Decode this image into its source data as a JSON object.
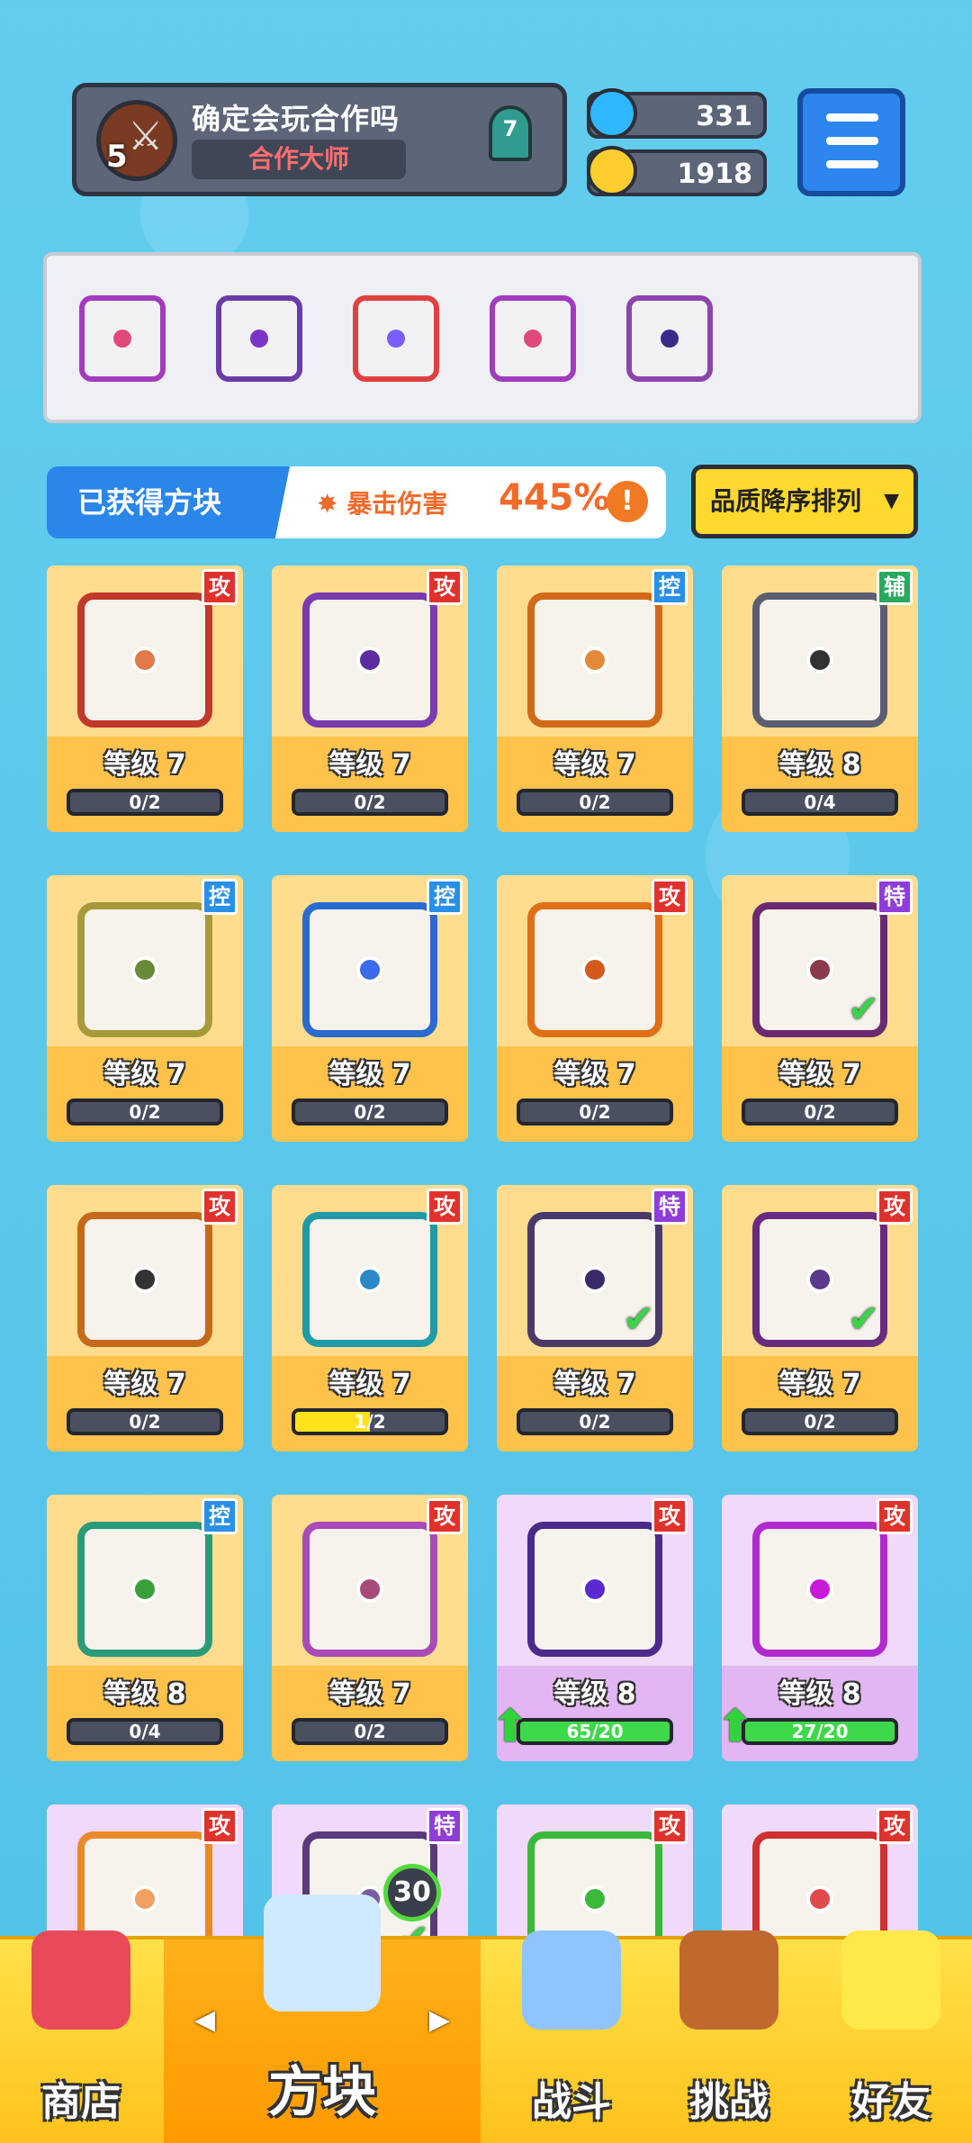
{
  "player": {
    "name": "确定会玩合作吗",
    "title": "合作大师",
    "level": "5",
    "rank": "7"
  },
  "currency": {
    "gems": "331",
    "gold": "1918"
  },
  "deck": [
    {
      "icon": "combo-block",
      "color": "#a23bc0",
      "dot": "#e04a7a"
    },
    {
      "icon": "vortex-block",
      "color": "#6b3ba8",
      "dot": "#7a34c8"
    },
    {
      "icon": "rainbow-block",
      "color": "#e04040",
      "dot": "#7a5cff"
    },
    {
      "icon": "crossbow-block",
      "color": "#a23bc0",
      "dot": "#e04a7a"
    },
    {
      "icon": "lightning-block",
      "color": "#8e44ad",
      "dot": "#3a2a8a"
    }
  ],
  "obtained": {
    "label": "已获得方块",
    "stat_label": "暴击伤害",
    "stat_value": "445%",
    "info": "!"
  },
  "sort": {
    "label": "品质降序排列",
    "arrow": "▼"
  },
  "cards": [
    {
      "icon": "sun-block",
      "tag": "攻",
      "tag_type": "atk",
      "frame": "#c0392b",
      "dot": "#e07a4a",
      "level": "等级 7",
      "progress": "0/2",
      "fill": 0,
      "purple": false,
      "check": false
    },
    {
      "icon": "vortex-block",
      "tag": "攻",
      "tag_type": "atk",
      "frame": "#7a3bb0",
      "dot": "#5b2ea0",
      "level": "等级 7",
      "progress": "0/2",
      "fill": 0,
      "purple": false,
      "check": false
    },
    {
      "icon": "tornado-block",
      "tag": "控",
      "tag_type": "ctl",
      "frame": "#d06a18",
      "dot": "#e38a3a",
      "level": "等级 7",
      "progress": "0/2",
      "fill": 0,
      "purple": false,
      "check": false
    },
    {
      "icon": "fang-block",
      "tag": "辅",
      "tag_type": "sup",
      "frame": "#5a5e70",
      "dot": "#333",
      "level": "等级 8",
      "progress": "0/4",
      "fill": 0,
      "purple": false,
      "check": false
    },
    {
      "icon": "shield-block",
      "tag": "控",
      "tag_type": "ctl",
      "frame": "#a89a3a",
      "dot": "#6a8a3a",
      "level": "等级 7",
      "progress": "0/2",
      "fill": 0,
      "purple": false,
      "check": false
    },
    {
      "icon": "snowflake-block",
      "tag": "控",
      "tag_type": "ctl",
      "frame": "#2a6bd0",
      "dot": "#3a6be8",
      "level": "等级 7",
      "progress": "0/2",
      "fill": 0,
      "purple": false,
      "check": false
    },
    {
      "icon": "flame-block",
      "tag": "攻",
      "tag_type": "atk",
      "frame": "#e07018",
      "dot": "#d45a1a",
      "level": "等级 7",
      "progress": "0/2",
      "fill": 0,
      "purple": false,
      "check": false
    },
    {
      "icon": "crossed-swords-block",
      "tag": "特",
      "tag_type": "spe",
      "frame": "#6a2a70",
      "dot": "#8a3a4a",
      "level": "等级 7",
      "progress": "0/2",
      "fill": 0,
      "purple": false,
      "check": true
    },
    {
      "icon": "pistol-block",
      "tag": "攻",
      "tag_type": "atk",
      "frame": "#c46a1a",
      "dot": "#333",
      "level": "等级 7",
      "progress": "0/2",
      "fill": 0,
      "purple": false,
      "check": false
    },
    {
      "icon": "whirlpool-block",
      "tag": "攻",
      "tag_type": "atk",
      "frame": "#1f9aa8",
      "dot": "#2a8ac8",
      "level": "等级 7",
      "progress": "1/2",
      "fill": 0.5,
      "purple": false,
      "check": false
    },
    {
      "icon": "void-block",
      "tag": "特",
      "tag_type": "spe",
      "frame": "#4a3a6a",
      "dot": "#3a2a6a",
      "level": "等级 7",
      "progress": "0/2",
      "fill": 0,
      "purple": false,
      "check": true
    },
    {
      "icon": "combo-block",
      "tag": "攻",
      "tag_type": "atk",
      "frame": "#6a2a80",
      "dot": "#5a3a8a",
      "level": "等级 7",
      "progress": "0/2",
      "fill": 0,
      "purple": false,
      "check": true
    },
    {
      "icon": "wind-block",
      "tag": "控",
      "tag_type": "ctl",
      "frame": "#2a9a7a",
      "dot": "#3aa03a",
      "level": "等级 8",
      "progress": "0/4",
      "fill": 0,
      "purple": false,
      "check": false
    },
    {
      "icon": "star-block",
      "tag": "攻",
      "tag_type": "atk",
      "frame": "#a84ab8",
      "dot": "#a84a7a",
      "level": "等级 7",
      "progress": "0/2",
      "fill": 0,
      "purple": false,
      "check": false
    },
    {
      "icon": "scythe-block",
      "tag": "攻",
      "tag_type": "atk",
      "frame": "#4a2a8a",
      "dot": "#5a2ad0",
      "level": "等级 8",
      "progress": "65/20",
      "fill": 1,
      "purple": true,
      "check": false,
      "upgrade": true
    },
    {
      "icon": "sparkle-block",
      "tag": "攻",
      "tag_type": "atk",
      "frame": "#b02ad0",
      "dot": "#c81ad8",
      "level": "等级 8",
      "progress": "27/20",
      "fill": 1,
      "purple": true,
      "check": false,
      "upgrade": true
    },
    {
      "icon": "crosshair-block",
      "tag": "攻",
      "tag_type": "atk",
      "frame": "#e88a2a",
      "dot": "#f0a060",
      "level": "",
      "progress": "",
      "fill": 0,
      "purple": true,
      "check": false,
      "partial": true
    },
    {
      "icon": "diamond-block",
      "tag": "特",
      "tag_type": "spe",
      "frame": "#5a3a7a",
      "dot": "#7a5aa0",
      "level": "",
      "progress": "",
      "fill": 0,
      "purple": true,
      "check": true,
      "partial": true
    },
    {
      "icon": "biohazard-block",
      "tag": "攻",
      "tag_type": "atk",
      "frame": "#3ab83a",
      "dot": "#3ab83a",
      "level": "",
      "progress": "",
      "fill": 0,
      "purple": true,
      "check": false,
      "partial": true
    },
    {
      "icon": "lightning-block",
      "tag": "攻",
      "tag_type": "atk",
      "frame": "#d03030",
      "dot": "#e04a4a",
      "level": "",
      "progress": "",
      "fill": 0,
      "purple": true,
      "check": false,
      "partial": true
    }
  ],
  "nav": {
    "shop": "商店",
    "blocks": "方块",
    "battle": "战斗",
    "challenge": "挑战",
    "friends": "好友",
    "chest_count": "30",
    "prev": "◀",
    "next": "▶"
  }
}
